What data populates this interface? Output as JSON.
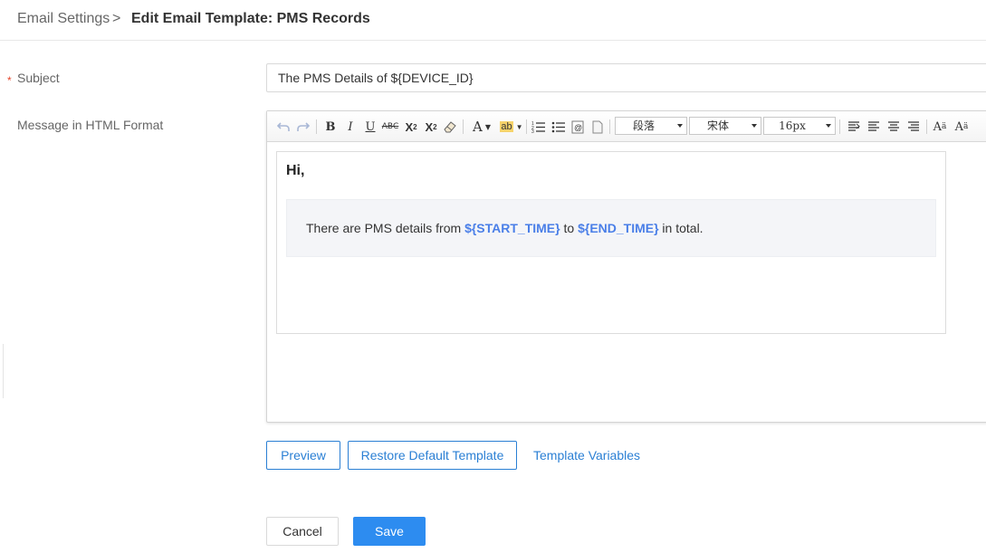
{
  "breadcrumb": {
    "parent": "Email Settings",
    "separator": ">",
    "current": "Edit Email Template: PMS Records"
  },
  "form": {
    "subject_label": "Subject",
    "required_mark": "*",
    "subject_value": "The PMS Details of ${DEVICE_ID}",
    "message_label": "Message in HTML Format"
  },
  "toolbar": {
    "paragraph": "段落",
    "font_family": "宋体",
    "font_size": "16px",
    "icons": [
      "undo-icon",
      "redo-icon",
      "bold-icon",
      "italic-icon",
      "underline-icon",
      "strikethrough-icon",
      "superscript-icon",
      "subscript-icon",
      "eraser-icon",
      "font-color-icon",
      "highlight-icon",
      "ordered-list-icon",
      "unordered-list-icon",
      "insert-variable-icon",
      "page-icon",
      "align-left-icon",
      "align-center-icon",
      "align-justify-icon",
      "align-right-icon",
      "font-increase-icon",
      "font-decrease-icon"
    ]
  },
  "editor": {
    "greeting": "Hi,",
    "msg_before": "There are PMS details from ",
    "var_start": "${START_TIME}",
    "msg_middle": " to ",
    "var_end": "${END_TIME}",
    "msg_after": " in total."
  },
  "actions": {
    "preview": "Preview",
    "restore": "Restore Default Template",
    "variables": "Template Variables",
    "cancel": "Cancel",
    "save": "Save"
  },
  "colors": {
    "accent": "#2a7fd4",
    "primary": "#2d8cf0",
    "variable": "#4a7fe8",
    "required": "#e5462c"
  }
}
